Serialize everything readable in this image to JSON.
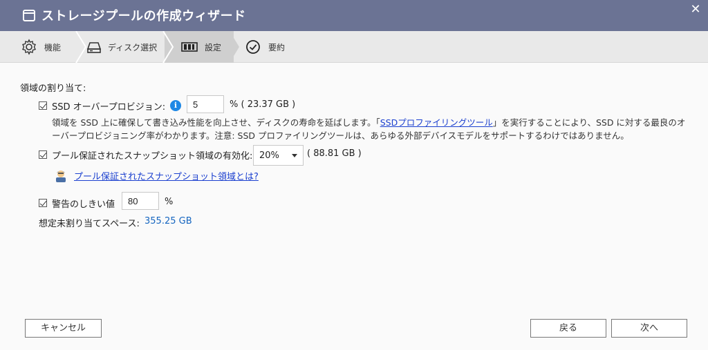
{
  "window": {
    "title": "ストレージプールの作成ウィザード",
    "close_glyph": "✕"
  },
  "steps": [
    {
      "label": "機能",
      "icon": "gear-icon"
    },
    {
      "label": "ディスク選択",
      "icon": "disk-icon"
    },
    {
      "label": "設定",
      "icon": "settings-icon",
      "active": true
    },
    {
      "label": "要約",
      "icon": "check-circle-icon"
    }
  ],
  "allocation": {
    "section_title": "領域の割り当て:",
    "ssd_overprovision": {
      "label": "SSD オーバープロビジョン:",
      "info_glyph": "i",
      "value": "5",
      "unit_text": "% ( 23.37 GB )",
      "checked": true
    },
    "description": {
      "part1": "領域を SSD 上に確保して書き込み性能を向上させ、ディスクの寿命を延ばします。「",
      "link": "SSDプロファイリングツール",
      "part2": "」を実行することにより、SSD に対する最良のオーバープロビジョニング率がわかります。注意: SSD プロファイリングツールは、あらゆる外部デバイスモデルをサポートするわけではありません。"
    },
    "snapshot": {
      "label": "プール保証されたスナップショット領域の有効化:",
      "selected": "20%",
      "size_text": "( 88.81 GB )",
      "checked": true
    },
    "snapshot_link": "プール保証されたスナップショット領域とは?",
    "threshold": {
      "label": "警告のしきい値",
      "value": "80",
      "unit": "%",
      "checked": true
    },
    "unallocated": {
      "label": "想定未割り当てスペース:",
      "value": "355.25 GB"
    }
  },
  "footer": {
    "cancel": "キャンセル",
    "back": "戻る",
    "next": "次へ"
  },
  "colors": {
    "titlebar": "#6b7394",
    "link": "#1a3fcf",
    "value_blue": "#1565c0",
    "info": "#1e88e5"
  }
}
